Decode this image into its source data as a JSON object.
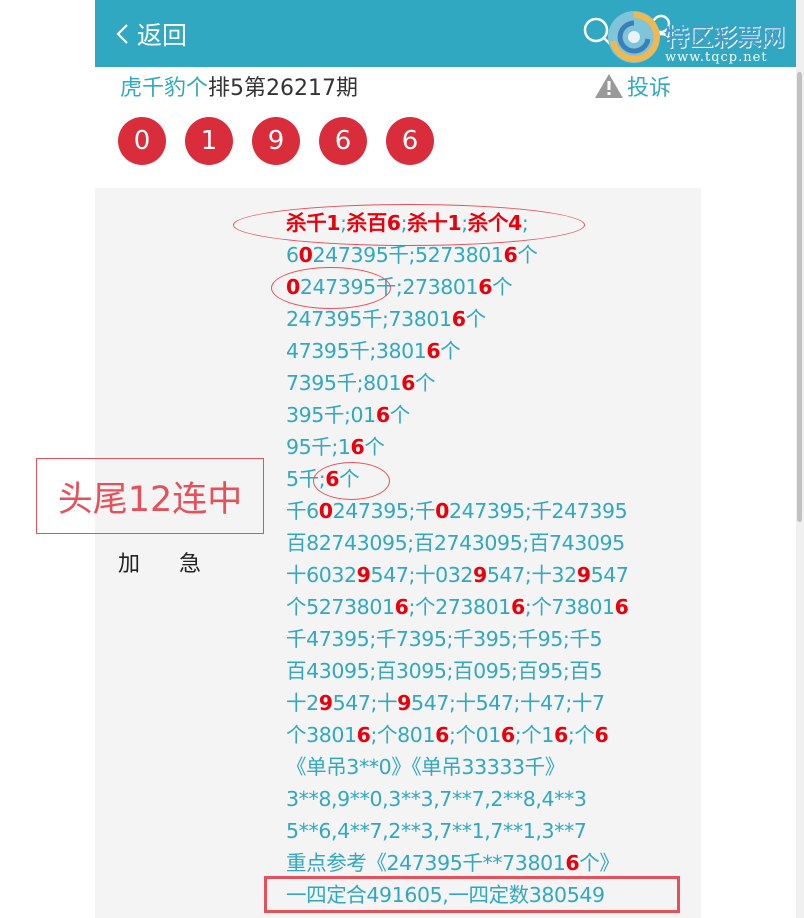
{
  "header": {
    "back_label": "返回",
    "logo_text": "特区彩票网",
    "logo_url": "www.tqcp.net",
    "color": "#30a8c1"
  },
  "title": {
    "author": "虎千豹个",
    "issue": "排5第26217期"
  },
  "complaint_label": "投诉",
  "balls": [
    "0",
    "1",
    "9",
    "6",
    "6"
  ],
  "ball_color": "#d92d3c",
  "badge_text": "头尾12连中",
  "urgent_label": "加 急",
  "lines": [
    [
      {
        "t": "杀千1",
        "r": true
      },
      {
        "t": ";"
      },
      {
        "t": "杀百6",
        "r": true
      },
      {
        "t": ";"
      },
      {
        "t": "杀十1",
        "r": true
      },
      {
        "t": ";"
      },
      {
        "t": "杀个4",
        "r": true
      },
      {
        "t": ";"
      }
    ],
    [
      {
        "t": "6"
      },
      {
        "t": "0",
        "r": true
      },
      {
        "t": "247395千;527380"
      },
      {
        "t": "16",
        "r": false
      },
      {
        "t": "个"
      }
    ],
    [
      {
        "t": "0",
        "r": true
      },
      {
        "t": "247395千;273801"
      },
      {
        "t": "6",
        "r": true
      },
      {
        "t": "个"
      }
    ],
    [
      {
        "t": "247395千;73801"
      },
      {
        "t": "6",
        "r": true
      },
      {
        "t": "个"
      }
    ],
    [
      {
        "t": "47395千;3801"
      },
      {
        "t": "6",
        "r": true
      },
      {
        "t": "个"
      }
    ],
    [
      {
        "t": "7395千;801"
      },
      {
        "t": "6",
        "r": true
      },
      {
        "t": "个"
      }
    ],
    [
      {
        "t": "395千;01"
      },
      {
        "t": "6",
        "r": true
      },
      {
        "t": "个"
      }
    ],
    [
      {
        "t": "95千;1"
      },
      {
        "t": "6",
        "r": true
      },
      {
        "t": "个"
      }
    ],
    [
      {
        "t": "5千;"
      },
      {
        "t": "6",
        "r": true
      },
      {
        "t": "个"
      }
    ],
    [
      {
        "t": "千6"
      },
      {
        "t": "0",
        "r": true
      },
      {
        "t": "247395;千"
      },
      {
        "t": "0",
        "r": true
      },
      {
        "t": "247395;千247395"
      }
    ],
    [
      {
        "t": "百82743095;百2743095;百743095"
      }
    ],
    [
      {
        "t": "十6032"
      },
      {
        "t": "9",
        "r": true
      },
      {
        "t": "547;十032"
      },
      {
        "t": "9",
        "r": true
      },
      {
        "t": "547;十32"
      },
      {
        "t": "9",
        "r": true
      },
      {
        "t": "547"
      }
    ],
    [
      {
        "t": "个5273801"
      },
      {
        "t": "6",
        "r": true
      },
      {
        "t": ";个273801"
      },
      {
        "t": "6",
        "r": true
      },
      {
        "t": ";个73801"
      },
      {
        "t": "6",
        "r": true
      }
    ],
    [
      {
        "t": "千47395;千7395;千395;千95;千5"
      }
    ],
    [
      {
        "t": "百43095;百3095;百095;百95;百5"
      }
    ],
    [
      {
        "t": "十2"
      },
      {
        "t": "9",
        "r": true
      },
      {
        "t": "547;十"
      },
      {
        "t": "9",
        "r": true
      },
      {
        "t": "547;十547;十47;十7"
      }
    ],
    [
      {
        "t": "个3801"
      },
      {
        "t": "6",
        "r": true
      },
      {
        "t": ";个801"
      },
      {
        "t": "6",
        "r": true
      },
      {
        "t": ";个01"
      },
      {
        "t": "6",
        "r": true
      },
      {
        "t": ";个1"
      },
      {
        "t": "6",
        "r": true
      },
      {
        "t": ";个"
      },
      {
        "t": "6",
        "r": true
      }
    ],
    [
      {
        "t": "《单吊3**0》《单吊33333千》"
      }
    ],
    [
      {
        "t": "3**8,9**0,3**3,7**7,2**8,4**3"
      }
    ],
    [
      {
        "t": "5**6,4**7,2**3,7**1,7**1,3**7"
      }
    ],
    [
      {
        "t": "重点参考《247395千**73801"
      },
      {
        "t": "6",
        "r": true
      },
      {
        "t": "个》"
      }
    ],
    [
      {
        "t": "一四定合491605,一四定数380549"
      }
    ]
  ]
}
